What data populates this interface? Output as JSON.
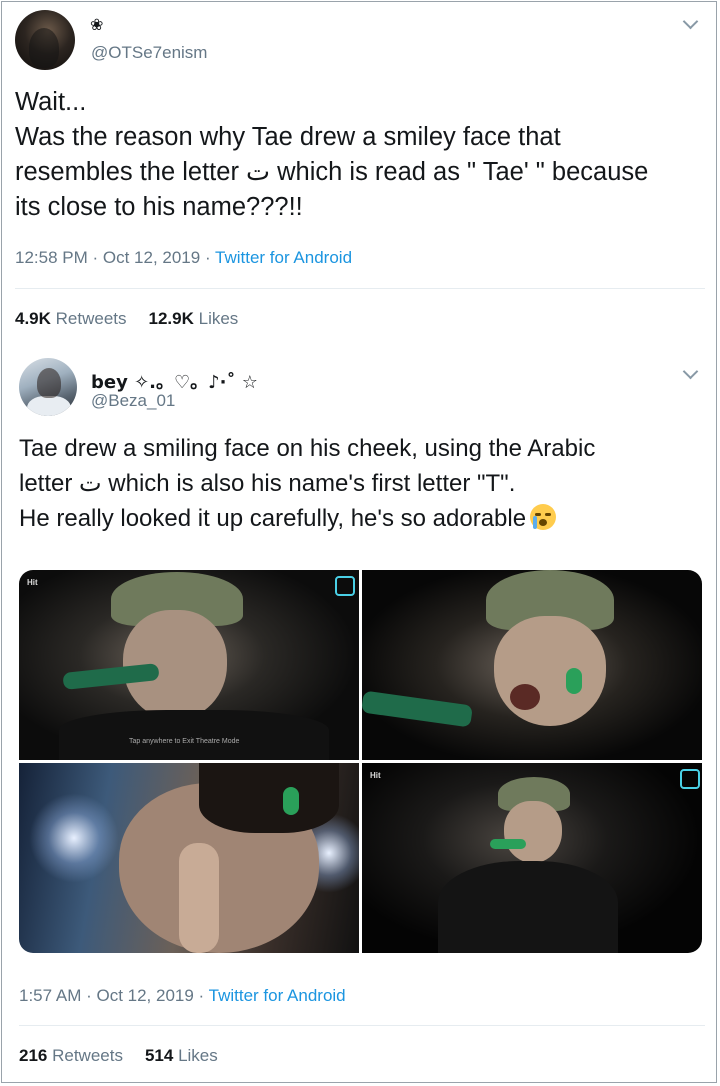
{
  "tweet1": {
    "name": "❀",
    "handle": "@OTSe7enism",
    "text": "Wait...\nWas the reason why Tae drew a smiley face that\nresembles the letter ت which is read as \" Tae' \" because\nits close to his name???!!",
    "time": "12:58 PM · Oct 12, 2019 · ",
    "source": "Twitter for Android",
    "retweets": "4.9K",
    "retweets_label": " Retweets",
    "likes": "12.9K",
    "likes_label": " Likes"
  },
  "tweet2": {
    "name": "bey ✧.。♡。♪·˚ ☆",
    "handle": "@Beza_01",
    "text": "Tae drew a smiling face on his cheek, using the Arabic\nletter ت which is also his name's first letter \"T\".\nHe really looked it up carefully, he's so adorable",
    "emoji": "loudly-crying-face",
    "time": "1:57 AM · Oct 12, 2019 · ",
    "source": "Twitter for Android",
    "retweets": "216",
    "retweets_label": " Retweets",
    "likes": "514",
    "likes_label": " Likes",
    "photos": [
      {
        "logo": "Hit",
        "caption": "Tap anywhere to Exit Theatre Mode"
      },
      {
        "logo": ""
      },
      {
        "logo": ""
      },
      {
        "logo": "Hit"
      }
    ]
  },
  "colors": {
    "link": "#1b95e0",
    "muted": "#657786",
    "text": "#14171a"
  }
}
